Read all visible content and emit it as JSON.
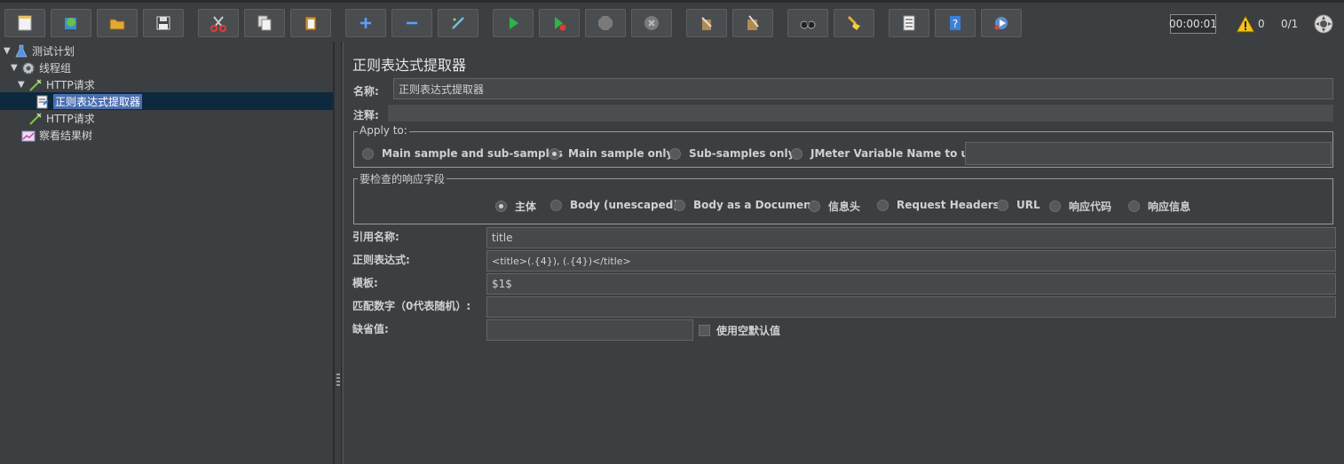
{
  "toolbar": {
    "buttons": [
      {
        "name": "new-icon"
      },
      {
        "name": "templates-icon"
      },
      {
        "name": "open-icon"
      },
      {
        "name": "save-icon"
      },
      {
        "name": "cut-icon"
      },
      {
        "name": "copy-icon"
      },
      {
        "name": "paste-icon"
      },
      {
        "name": "expand-icon"
      },
      {
        "name": "collapse-icon"
      },
      {
        "name": "toggle-icon"
      },
      {
        "name": "start-icon"
      },
      {
        "name": "start-no-pauses-icon"
      },
      {
        "name": "stop-icon"
      },
      {
        "name": "shutdown-icon"
      },
      {
        "name": "clear-icon"
      },
      {
        "name": "clear-all-icon"
      },
      {
        "name": "search-icon"
      },
      {
        "name": "reset-search-icon"
      },
      {
        "name": "function-helper-icon"
      },
      {
        "name": "help-icon"
      },
      {
        "name": "remote-start-icon"
      }
    ],
    "timer": "00:00:01",
    "warning_count": "0",
    "threads": "0/1"
  },
  "tree": {
    "items": [
      {
        "label": "测试计划",
        "icon": "test-plan-icon"
      },
      {
        "label": "线程组",
        "icon": "thread-group-icon"
      },
      {
        "label": "HTTP请求",
        "icon": "http-sampler-icon"
      },
      {
        "label": "正则表达式提取器",
        "icon": "regex-extractor-icon",
        "selected": true
      },
      {
        "label": "HTTP请求",
        "icon": "http-sampler-icon"
      },
      {
        "label": "察看结果树",
        "icon": "view-results-tree-icon"
      }
    ]
  },
  "panel": {
    "title": "正则表达式提取器",
    "name_label": "名称:",
    "name_value": "正则表达式提取器",
    "comment_label": "注释:",
    "comment_value": "",
    "apply_to": {
      "legend": "Apply to:",
      "options": [
        "Main sample and sub-samples",
        "Main sample only",
        "Sub-samples only",
        "JMeter Variable Name to use"
      ],
      "selected": "Main sample only",
      "variable_value": ""
    },
    "field_to_check": {
      "legend": "要检查的响应字段",
      "options": [
        "主体",
        "Body (unescaped)",
        "Body as a Document",
        "信息头",
        "Request Headers",
        "URL",
        "响应代码",
        "响应信息"
      ],
      "selected": "主体"
    },
    "ref_name_label": "引用名称:",
    "ref_name_value": "title",
    "regex_label": "正则表达式:",
    "regex_value": "<title>(.{4}), (.{4})</title>",
    "template_label": "模板:",
    "template_value": "$1$",
    "match_no_label": "匹配数字（0代表随机）:",
    "match_no_value": "",
    "default_label": "缺省值:",
    "default_value": "",
    "use_empty_default_label": "使用空默认值",
    "use_empty_default_checked": false
  },
  "colors": {
    "background": "#3c3f41",
    "field_bg": "#45494a",
    "selection": "#4b6eaf",
    "selected_row": "#0d293e"
  }
}
